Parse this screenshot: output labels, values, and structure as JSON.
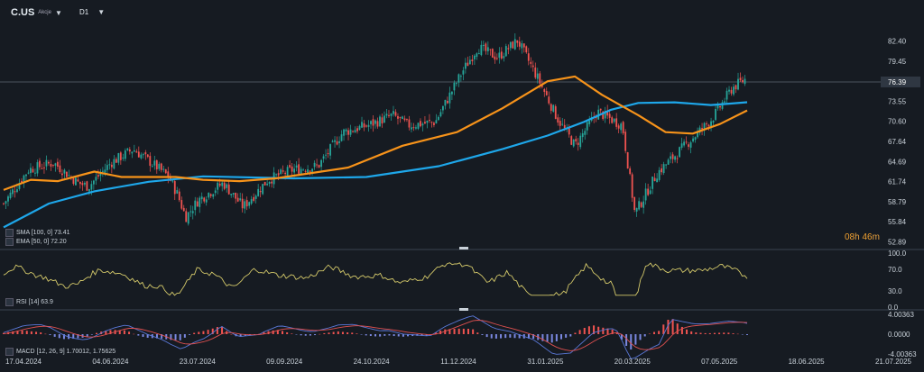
{
  "header": {
    "symbol": "C.US",
    "subtitle": "Akcje",
    "timeframe": "D1"
  },
  "price_axis": {
    "ticks": [
      "82.40",
      "79.45",
      "76.39",
      "73.55",
      "70.60",
      "67.64",
      "64.69",
      "61.74",
      "58.79",
      "55.84",
      "52.89"
    ],
    "current": "76.39"
  },
  "rsi_axis": {
    "ticks": [
      "100.0",
      "70.0",
      "30.0",
      "0.0"
    ]
  },
  "macd_axis": {
    "ticks": [
      "4.00363",
      "0.0000",
      "-4.00363"
    ]
  },
  "date_axis": [
    "17.04.2024",
    "04.06.2024",
    "23.07.2024",
    "09.09.2024",
    "24.10.2024",
    "11.12.2024",
    "31.01.2025",
    "20.03.2025",
    "07.05.2025",
    "18.06.2025",
    "21.07.2025"
  ],
  "legend": {
    "sma": "SMA [100, 0] 73.41",
    "ema": "EMA [50, 0] 72.20",
    "rsi": "RSI [14] 63.9",
    "macd": "MACD [12, 26, 9] 1.70012, 1.75625"
  },
  "timer": {
    "hours": "08",
    "h": "h",
    "minutes": "46",
    "m": "m"
  },
  "colors": {
    "bg": "#161b22",
    "up": "#26a69a",
    "down": "#ef5350",
    "sma": "#1ea7ea",
    "ema": "#f7931a",
    "rsi": "#d4c96a",
    "macd_line": "#5a78d8",
    "signal_line": "#e05050",
    "hist_pos": "#ef5350",
    "hist_neg": "#7a88e0"
  },
  "chart_data": {
    "type": "candlestick",
    "ylim": [
      52.89,
      85.4
    ],
    "x": [
      "17.04.2024",
      "04.06.2024",
      "23.07.2024",
      "09.09.2024",
      "24.10.2024",
      "11.12.2024",
      "31.01.2025",
      "20.03.2025",
      "07.05.2025",
      "21.05.2025"
    ],
    "close_path": [
      [
        "17.04.2024",
        58.5
      ],
      [
        "01.05.2024",
        63.5
      ],
      [
        "15.05.2024",
        64.5
      ],
      [
        "29.05.2024",
        61.5
      ],
      [
        "04.06.2024",
        61.0
      ],
      [
        "18.06.2024",
        64.5
      ],
      [
        "02.07.2024",
        66.5
      ],
      [
        "16.07.2024",
        64.0
      ],
      [
        "23.07.2024",
        62.5
      ],
      [
        "31.07.2024",
        60.0
      ],
      [
        "05.08.2024",
        56.5
      ],
      [
        "14.08.2024",
        59.0
      ],
      [
        "28.08.2024",
        61.5
      ],
      [
        "09.09.2024",
        58.0
      ],
      [
        "23.09.2024",
        62.0
      ],
      [
        "07.10.2024",
        63.5
      ],
      [
        "24.10.2024",
        64.0
      ],
      [
        "07.11.2024",
        69.0
      ],
      [
        "21.11.2024",
        70.0
      ],
      [
        "04.12.2024",
        71.5
      ],
      [
        "11.12.2024",
        70.0
      ],
      [
        "31.12.2024",
        70.5
      ],
      [
        "15.01.2025",
        78.0
      ],
      [
        "23.01.2025",
        81.5
      ],
      [
        "31.01.2025",
        80.0
      ],
      [
        "10.02.2025",
        82.5
      ],
      [
        "21.02.2025",
        77.0
      ],
      [
        "03.03.2025",
        71.0
      ],
      [
        "11.03.2025",
        67.0
      ],
      [
        "20.03.2025",
        72.0
      ],
      [
        "01.04.2025",
        70.0
      ],
      [
        "07.04.2025",
        57.0
      ],
      [
        "17.04.2025",
        63.0
      ],
      [
        "29.04.2025",
        67.0
      ],
      [
        "07.05.2025",
        71.0
      ],
      [
        "15.05.2025",
        75.5
      ],
      [
        "21.05.2025",
        77.0
      ]
    ],
    "series": [
      {
        "name": "SMA [100, 0]",
        "values": [
          [
            0,
            55.0
          ],
          [
            5,
            58.5
          ],
          [
            10,
            60.3
          ],
          [
            16,
            61.7
          ],
          [
            22,
            62.5
          ],
          [
            32,
            62.2
          ],
          [
            40,
            62.4
          ],
          [
            48,
            64.0
          ],
          [
            55,
            66.5
          ],
          [
            60,
            68.5
          ],
          [
            64,
            70.5
          ],
          [
            67,
            72.3
          ],
          [
            70,
            73.3
          ],
          [
            74,
            73.4
          ],
          [
            78,
            73.0
          ],
          [
            80,
            73.2
          ],
          [
            82,
            73.41
          ]
        ]
      },
      {
        "name": "EMA [50, 0]",
        "values": [
          [
            0,
            60.5
          ],
          [
            3,
            62.0
          ],
          [
            6,
            61.8
          ],
          [
            10,
            63.2
          ],
          [
            13,
            62.4
          ],
          [
            19,
            62.4
          ],
          [
            22,
            62.0
          ],
          [
            26,
            61.8
          ],
          [
            30,
            62.2
          ],
          [
            38,
            63.8
          ],
          [
            44,
            67.0
          ],
          [
            50,
            69.0
          ],
          [
            55,
            72.5
          ],
          [
            60,
            76.5
          ],
          [
            63,
            77.2
          ],
          [
            66,
            74.5
          ],
          [
            70,
            71.5
          ],
          [
            73,
            69.0
          ],
          [
            76,
            68.8
          ],
          [
            79,
            70.2
          ],
          [
            82,
            72.2
          ]
        ]
      }
    ],
    "last_value": 76.39
  }
}
